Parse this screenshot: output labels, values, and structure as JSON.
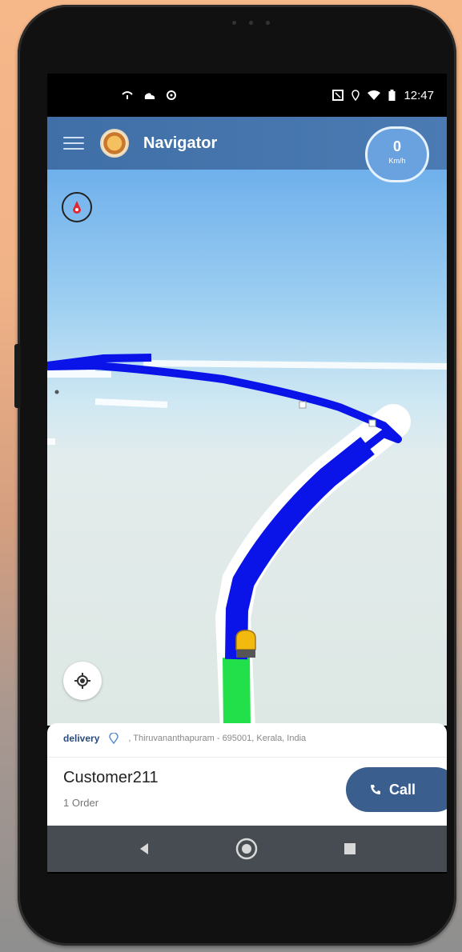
{
  "status_bar": {
    "time": "12:47"
  },
  "app_bar": {
    "title": "Navigator",
    "speed_value": "0",
    "speed_unit": "Km/h"
  },
  "info_card": {
    "type_label": "delivery",
    "address": ", Thiruvananthapuram - 695001, Kerala, India",
    "customer_name": "Customer211",
    "order_count": "1 Order",
    "call_label": "Call"
  },
  "colors": {
    "app_bar": "#4675ad",
    "route": "#0a14e8",
    "traveled": "#22e04a",
    "call_button": "#3a5f8e"
  },
  "icons": [
    "menu-icon",
    "app-logo-icon",
    "compass-icon",
    "locate-icon",
    "vehicle-icon",
    "location-pin-icon",
    "phone-icon",
    "back-icon",
    "home-icon",
    "recents-icon"
  ]
}
